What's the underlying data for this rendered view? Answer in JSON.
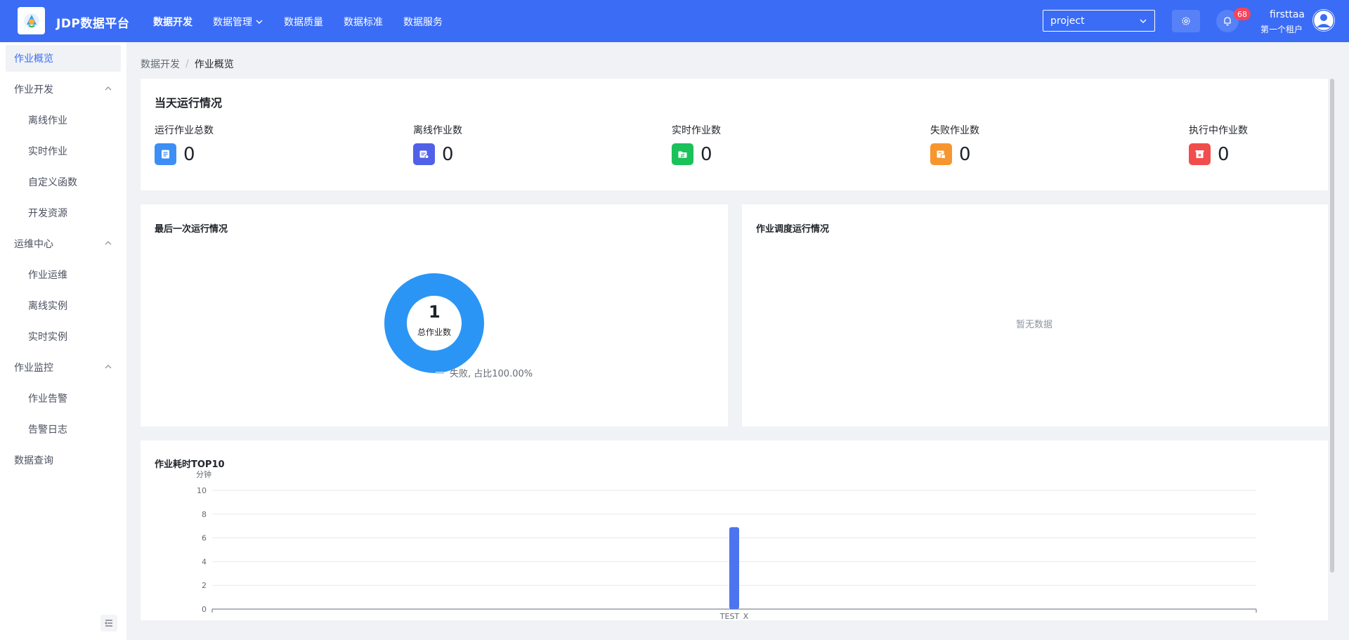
{
  "header": {
    "app_name": "JDP数据平台",
    "nav": [
      {
        "label": "数据开发",
        "active": true
      },
      {
        "label": "数据管理",
        "dropdown": true
      },
      {
        "label": "数据质量"
      },
      {
        "label": "数据标准"
      },
      {
        "label": "数据服务"
      }
    ],
    "project_value": "project",
    "notification_count": "68",
    "user_name": "firsttaa",
    "tenant": "第一个租户"
  },
  "sidebar": {
    "items": [
      {
        "label": "作业概览",
        "active": true
      },
      {
        "label": "作业开发",
        "group": true
      },
      {
        "label": "离线作业",
        "sub": true
      },
      {
        "label": "实时作业",
        "sub": true
      },
      {
        "label": "自定义函数",
        "sub": true
      },
      {
        "label": "开发资源",
        "sub": true
      },
      {
        "label": "运维中心",
        "group": true
      },
      {
        "label": "作业运维",
        "sub": true
      },
      {
        "label": "离线实例",
        "sub": true
      },
      {
        "label": "实时实例",
        "sub": true
      },
      {
        "label": "作业监控",
        "group": true
      },
      {
        "label": "作业告警",
        "sub": true
      },
      {
        "label": "告警日志",
        "sub": true
      },
      {
        "label": "数据查询"
      }
    ]
  },
  "breadcrumb": {
    "parent": "数据开发",
    "current": "作业概览"
  },
  "today": {
    "title": "当天运行情况",
    "stats": [
      {
        "label": "运行作业总数",
        "value": "0",
        "color": "#3d8ef5",
        "icon": "list-icon"
      },
      {
        "label": "离线作业数",
        "value": "0",
        "color": "#5160e8",
        "icon": "offline-job-icon"
      },
      {
        "label": "实时作业数",
        "value": "0",
        "color": "#1bc15a",
        "icon": "realtime-job-icon"
      },
      {
        "label": "失败作业数",
        "value": "0",
        "color": "#f7962e",
        "icon": "failed-job-icon"
      },
      {
        "label": "执行中作业数",
        "value": "0",
        "color": "#f24d4d",
        "icon": "running-job-icon"
      }
    ]
  },
  "last_run": {
    "title": "最后一次运行情况",
    "total": "1",
    "total_label": "总作业数",
    "legend": "失败, 占比100.00%",
    "color": "#2a95f5"
  },
  "schedule": {
    "title": "作业调度运行情况",
    "empty": "暂无数据"
  },
  "chart_data": {
    "type": "bar",
    "title": "作业耗时TOP10",
    "ylabel": "分钟",
    "categories": [
      "TEST"
    ],
    "values": [
      6.9
    ],
    "ylim": [
      0,
      10
    ],
    "yticks": [
      "0",
      "2",
      "4",
      "6",
      "8",
      "10"
    ],
    "xtick_label": "TEST_X",
    "color": "#4c74ef",
    "grid": true
  }
}
